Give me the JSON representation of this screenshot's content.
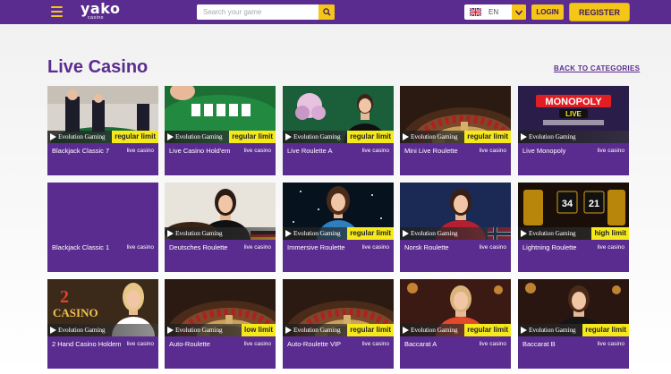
{
  "header": {
    "logo": "yako",
    "logo_sub": "casino",
    "search_placeholder": "Search your game",
    "language": "EN",
    "login_label": "LOGIN",
    "register_label": "REGISTER"
  },
  "page": {
    "title": "Live Casino",
    "back_link": "BACK TO CATEGORIES"
  },
  "provider_name": "Evolution Gaming",
  "games": [
    {
      "title": "Blackjack Classic 7",
      "category": "live casino",
      "limit": "regular limit",
      "art": "blackjack"
    },
    {
      "title": "Live Casino Hold'em",
      "category": "live casino",
      "limit": "regular limit",
      "art": "holdem"
    },
    {
      "title": "Live Roulette A",
      "category": "live casino",
      "limit": "regular limit",
      "art": "dealer-flowers"
    },
    {
      "title": "Mini Live Roulette",
      "category": "live casino",
      "limit": "regular limit",
      "art": "roulette"
    },
    {
      "title": "Live Monopoly",
      "category": "live casino",
      "limit": "",
      "art": "monopoly",
      "art_text": "MONOPOLY",
      "art_text2": "LIVE"
    },
    {
      "title": "Blackjack Classic 1",
      "category": "live casino",
      "limit": "",
      "art": "empty"
    },
    {
      "title": "Deutsches Roulette",
      "category": "live casino",
      "limit": "",
      "art": "dealer-de"
    },
    {
      "title": "Immersive Roulette",
      "category": "live casino",
      "limit": "regular limit",
      "art": "immersive"
    },
    {
      "title": "Norsk Roulette",
      "category": "live casino",
      "limit": "",
      "art": "dealer-no"
    },
    {
      "title": "Lightning Roulette",
      "category": "live casino",
      "limit": "high limit",
      "art": "lightning",
      "art_text": "34",
      "art_text2": "21"
    },
    {
      "title": "2 Hand Casino Holdem",
      "category": "live casino",
      "limit": "",
      "art": "holdem2",
      "art_text": "2",
      "art_text2": "CASINO"
    },
    {
      "title": "Auto-Roulette",
      "category": "live casino",
      "limit": "low limit",
      "art": "roulette"
    },
    {
      "title": "Auto-Roulette VIP",
      "category": "live casino",
      "limit": "regular limit",
      "art": "roulette"
    },
    {
      "title": "Baccarat A",
      "category": "live casino",
      "limit": "regular limit",
      "art": "baccarat-a"
    },
    {
      "title": "Baccarat B",
      "category": "live casino",
      "limit": "regular limit",
      "art": "baccarat-b"
    }
  ],
  "colors": {
    "brand_purple": "#5b2c8f",
    "accent_yellow": "#f5c518",
    "limit_yellow": "#f5e81b"
  }
}
